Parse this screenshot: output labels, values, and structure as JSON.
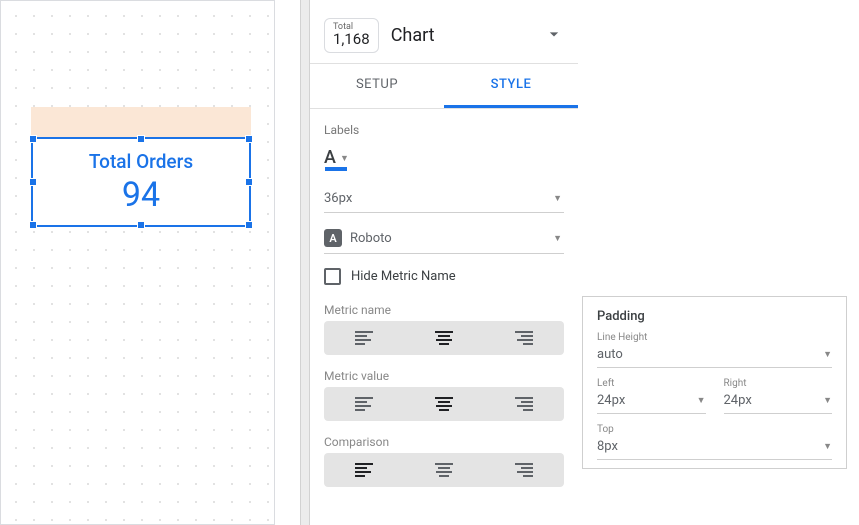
{
  "canvas": {
    "scorecard": {
      "metric_name": "Total Orders",
      "metric_value": "94"
    }
  },
  "panel": {
    "chip": {
      "label": "Total",
      "value": "1,168"
    },
    "title": "Chart",
    "tabs": {
      "setup": "SETUP",
      "style": "STYLE"
    },
    "labels_section": "Labels",
    "font_size": "36px",
    "font_family": "Roboto",
    "hide_metric_name": "Hide Metric Name",
    "align": {
      "metric_name_label": "Metric name",
      "metric_value_label": "Metric value",
      "comparison_label": "Comparison"
    }
  },
  "padding_popup": {
    "title": "Padding",
    "line_height_label": "Line Height",
    "line_height_value": "auto",
    "left_label": "Left",
    "left_value": "24px",
    "right_label": "Right",
    "right_value": "24px",
    "top_label": "Top",
    "top_value": "8px"
  }
}
